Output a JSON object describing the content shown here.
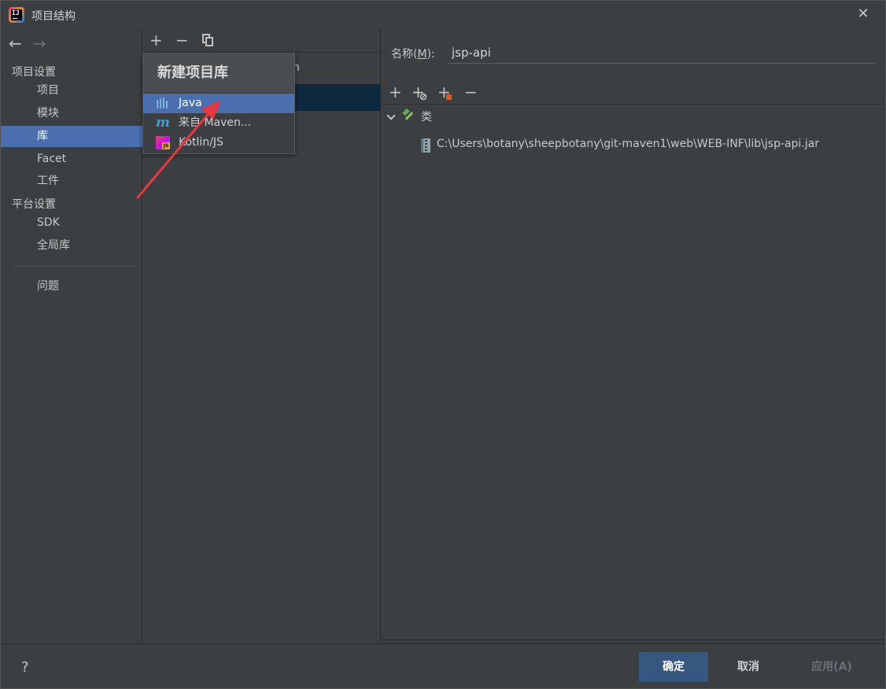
{
  "window": {
    "title": "项目结构",
    "close_glyph": "✕"
  },
  "nav": {
    "back_glyph": "←",
    "forward_glyph": "→",
    "project_settings_label": "项目设置",
    "project_items": [
      {
        "label": "项目",
        "selected": false
      },
      {
        "label": "模块",
        "selected": false
      },
      {
        "label": "库",
        "selected": true
      },
      {
        "label": "Facet",
        "selected": false
      },
      {
        "label": "工件",
        "selected": false
      }
    ],
    "platform_settings_label": "平台设置",
    "platform_items": [
      {
        "label": "SDK"
      },
      {
        "label": "全局库"
      }
    ],
    "problems_label": "问题"
  },
  "library_list": {
    "add_glyph": "+",
    "remove_glyph": "−",
    "header_text_fragment": "n"
  },
  "popup": {
    "title": "新建项目库",
    "items": [
      {
        "label": "Java",
        "icon": "java-library-icon",
        "selected": true
      },
      {
        "label": "来自 Maven...",
        "icon": "maven-icon",
        "selected": false
      },
      {
        "label": "Kotlin/JS",
        "icon": "kotlin-js-icon",
        "selected": false
      }
    ]
  },
  "details": {
    "name_label": "名称(",
    "name_mnemonic": "M",
    "name_label_end": "):",
    "name_value": "jsp-api",
    "add_glyph": "+",
    "remove_glyph": "−",
    "tree": {
      "category_label": "类",
      "entries": [
        "C:\\Users\\botany\\sheepbotany\\git-maven1\\web\\WEB-INF\\lib\\jsp-api.jar"
      ]
    }
  },
  "footer": {
    "help_label": "?",
    "ok_label": "确定",
    "cancel_label": "取消",
    "apply_label": "应用(A)"
  },
  "colors": {
    "background": "#3c3f41",
    "selection": "#4b6eaf",
    "primary_button": "#365880",
    "annotation_arrow": "#e8383d"
  }
}
